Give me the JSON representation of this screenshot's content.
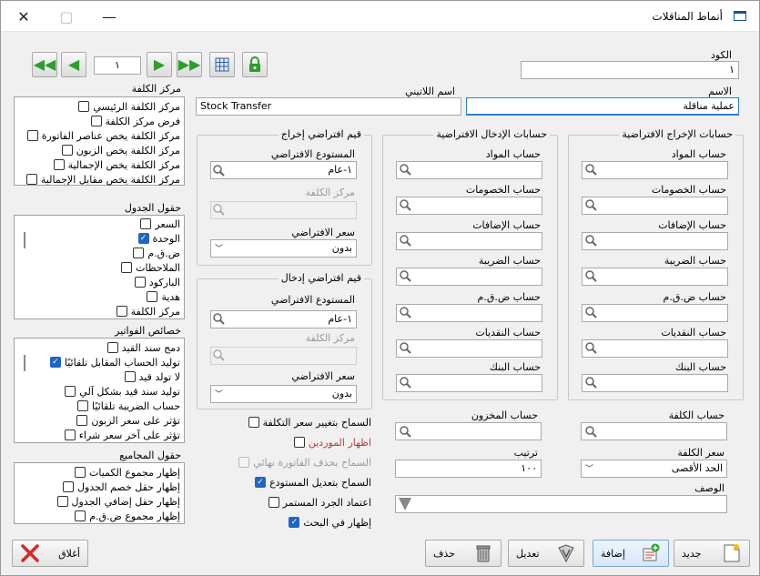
{
  "window": {
    "title": "أنماط المناقلات"
  },
  "nav": {
    "record_number": "١"
  },
  "header": {
    "code_label": "الكود",
    "code_value": "١",
    "name_label": "الاسم",
    "name_value": "عملية مناقلة",
    "latin_label": "اسم اللاتيني",
    "latin_value": "Stock Transfer"
  },
  "cost_center": {
    "title": "مركز الكلفة",
    "items": [
      {
        "label": "مركز الكلفة الرئيسي",
        "checked": false
      },
      {
        "label": "فرض مركز الكلفة",
        "checked": false
      },
      {
        "label": "مركز الكلفة يخص عناصر الفاتورة",
        "checked": false
      },
      {
        "label": "مركز الكلفة يخص الزبون",
        "checked": false
      },
      {
        "label": "مركز الكلفة يخص الإجمالية",
        "checked": false
      },
      {
        "label": "مركز الكلفة يخص مقابل الإجمالية",
        "checked": false
      }
    ]
  },
  "table_fields": {
    "title": "حقول الجدول",
    "items": [
      {
        "label": "السعر",
        "checked": false
      },
      {
        "label": "الوحدة",
        "checked": true
      },
      {
        "label": "ض.ق.م",
        "checked": false
      },
      {
        "label": "الملاحظات",
        "checked": false
      },
      {
        "label": "الباركود",
        "checked": false
      },
      {
        "label": "هدية",
        "checked": false
      },
      {
        "label": "مركز الكلفة",
        "checked": false
      }
    ]
  },
  "invoice_props": {
    "title": "خصائص الفواتير",
    "items": [
      {
        "label": "دمج سند القيد",
        "checked": false
      },
      {
        "label": "توليد الحساب المقابل تلقائيًا",
        "checked": true
      },
      {
        "label": "لا تولد قيد",
        "checked": false
      },
      {
        "label": "توليد سند قيد بشكل آلي",
        "checked": false
      },
      {
        "label": "حساب الضريبة تلقائيًا",
        "checked": false
      },
      {
        "label": "تؤثر على سعر الزبون",
        "checked": false
      },
      {
        "label": "تؤثر على آخر سعر شراء",
        "checked": false
      }
    ]
  },
  "totals_fields": {
    "title": "حقول المجاميع",
    "items": [
      {
        "label": "إظهار مجموع الكميات",
        "checked": false
      },
      {
        "label": "إظهار حقل خصم الجدول",
        "checked": false
      },
      {
        "label": "إظهار حقل إضافي الجدول",
        "checked": false
      },
      {
        "label": "إظهار مجموع ض.ق.م",
        "checked": false
      }
    ]
  },
  "out_defaults": {
    "title": "قيم افتراضي إخراج",
    "warehouse_label": "المستودع الافتراضي",
    "warehouse_value": "١-عام",
    "cost_center_label": "مركز الكلفة",
    "price_label": "سعر الافتراضي",
    "price_value": "بدون"
  },
  "in_defaults": {
    "title": "قيم افتراضي إدخال",
    "warehouse_label": "المستودع الافتراضي",
    "warehouse_value": "١-عام",
    "cost_center_label": "مركز الكلفة",
    "price_label": "سعر الافتراضي",
    "price_value": "بدون"
  },
  "in_accounts": {
    "title": "حسابات الإدخال الافتراضية",
    "fields": [
      "حساب المواد",
      "حساب الخصومات",
      "حساب الإضافات",
      "حساب الضريبة",
      "حساب ض.ق.م",
      "حساب النقديات",
      "حساب البنك"
    ]
  },
  "out_accounts": {
    "title": "حسابات الإخراج الافتراضية",
    "fields": [
      "حساب المواد",
      "حساب الخصومات",
      "حساب الإضافات",
      "حساب الضريبة",
      "حساب ض.ق.م",
      "حساب النقديات",
      "حساب البنك"
    ]
  },
  "options": {
    "items": [
      {
        "label": "السماح بتغيير سعر التكلفة",
        "checked": false,
        "style": "normal"
      },
      {
        "label": "اظهار الموردين",
        "checked": false,
        "style": "red"
      },
      {
        "label": "السماح بحذف الفاتورة نهائي",
        "checked": false,
        "style": "disabled"
      },
      {
        "label": "السماح بتعديل المستودع",
        "checked": true,
        "style": "normal"
      },
      {
        "label": "اعتماد الجرد المستمر",
        "checked": false,
        "style": "normal"
      },
      {
        "label": "إظهار في البحث",
        "checked": true,
        "style": "normal"
      }
    ]
  },
  "misc": {
    "stock_account_label": "حساب المخزون",
    "order_label": "ترتيب",
    "order_value": "١٠٠",
    "cost_account_label": "حساب الكلفة",
    "cost_price_label": "سعر الكلفة",
    "cost_price_value": "الحد الأقصى",
    "description_label": "الوصف"
  },
  "buttons": {
    "new": "جديد",
    "add": "إضافة",
    "edit": "تعديل",
    "delete": "حذف",
    "close": "أغلاق"
  },
  "colors": {
    "accent": "#1f66c4",
    "nav_arrow": "#2e9e2e",
    "close_x": "#d42a2a"
  }
}
